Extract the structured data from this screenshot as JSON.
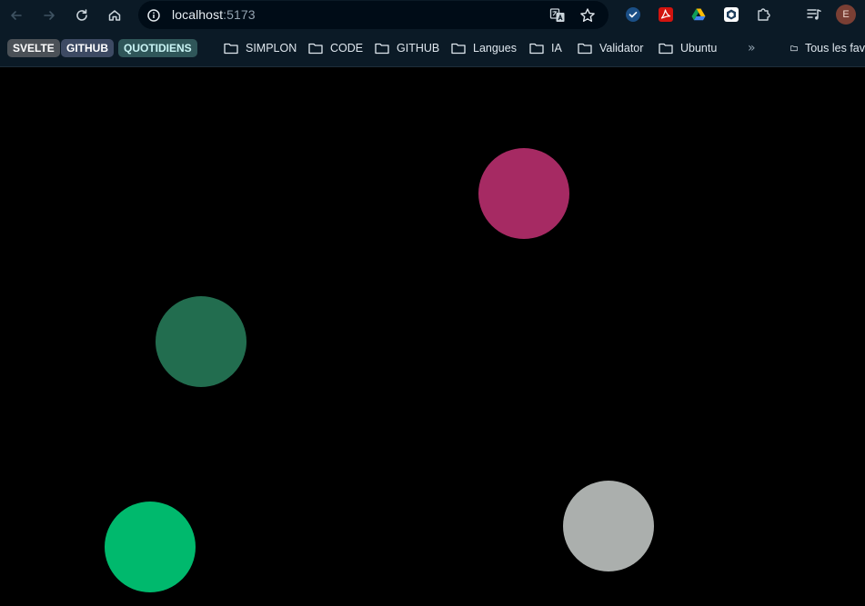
{
  "browser": {
    "url_host": "localhost",
    "url_port": ":5173",
    "profile_initial": "E"
  },
  "bookmarks_bar": {
    "pills": [
      {
        "label": "SVELTE",
        "bg": "#4b5157",
        "fg": "#ffffff"
      },
      {
        "label": "GITHUB",
        "bg": "#3d4a63",
        "fg": "#ffffff"
      },
      {
        "label": "QUOTIDIENS",
        "bg": "#2f5659",
        "fg": "#c9f4f4"
      }
    ],
    "folders": [
      {
        "label": "SIMPLON"
      },
      {
        "label": "CODE"
      },
      {
        "label": "GITHUB"
      },
      {
        "label": "Langues"
      },
      {
        "label": "IA"
      },
      {
        "label": "Validator"
      },
      {
        "label": "Ubuntu"
      }
    ],
    "overflow_chevron": "»",
    "all_bookmarks_label": "Tous les fav"
  },
  "canvas": {
    "circles": [
      {
        "name": "magenta-circle",
        "color": "#a62a63"
      },
      {
        "name": "dark-green-circle",
        "color": "#226d4f"
      },
      {
        "name": "green-circle",
        "color": "#00b96d"
      },
      {
        "name": "gray-circle",
        "color": "#abafad"
      }
    ]
  }
}
